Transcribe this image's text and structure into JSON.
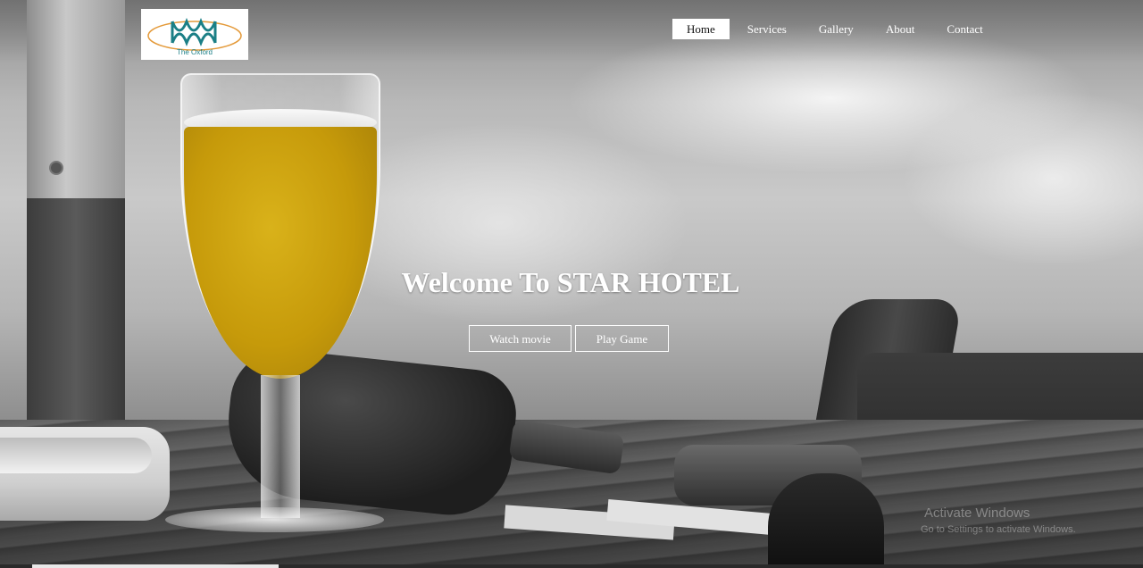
{
  "brand": {
    "logo_text": "The Oxford",
    "colors": {
      "teal": "#1b7f86",
      "orange": "#e49a3a"
    }
  },
  "nav": {
    "items": [
      {
        "label": "Home",
        "active": true
      },
      {
        "label": "Services",
        "active": false
      },
      {
        "label": "Gallery",
        "active": false
      },
      {
        "label": "About",
        "active": false
      },
      {
        "label": "Contact",
        "active": false
      }
    ]
  },
  "hero": {
    "title": "Welcome To STAR HOTEL",
    "buttons": {
      "watch_label": "Watch movie",
      "play_label": "Play Game"
    }
  },
  "os_watermark": {
    "line1": "Activate Windows",
    "line2": "Go to Settings to activate Windows."
  }
}
